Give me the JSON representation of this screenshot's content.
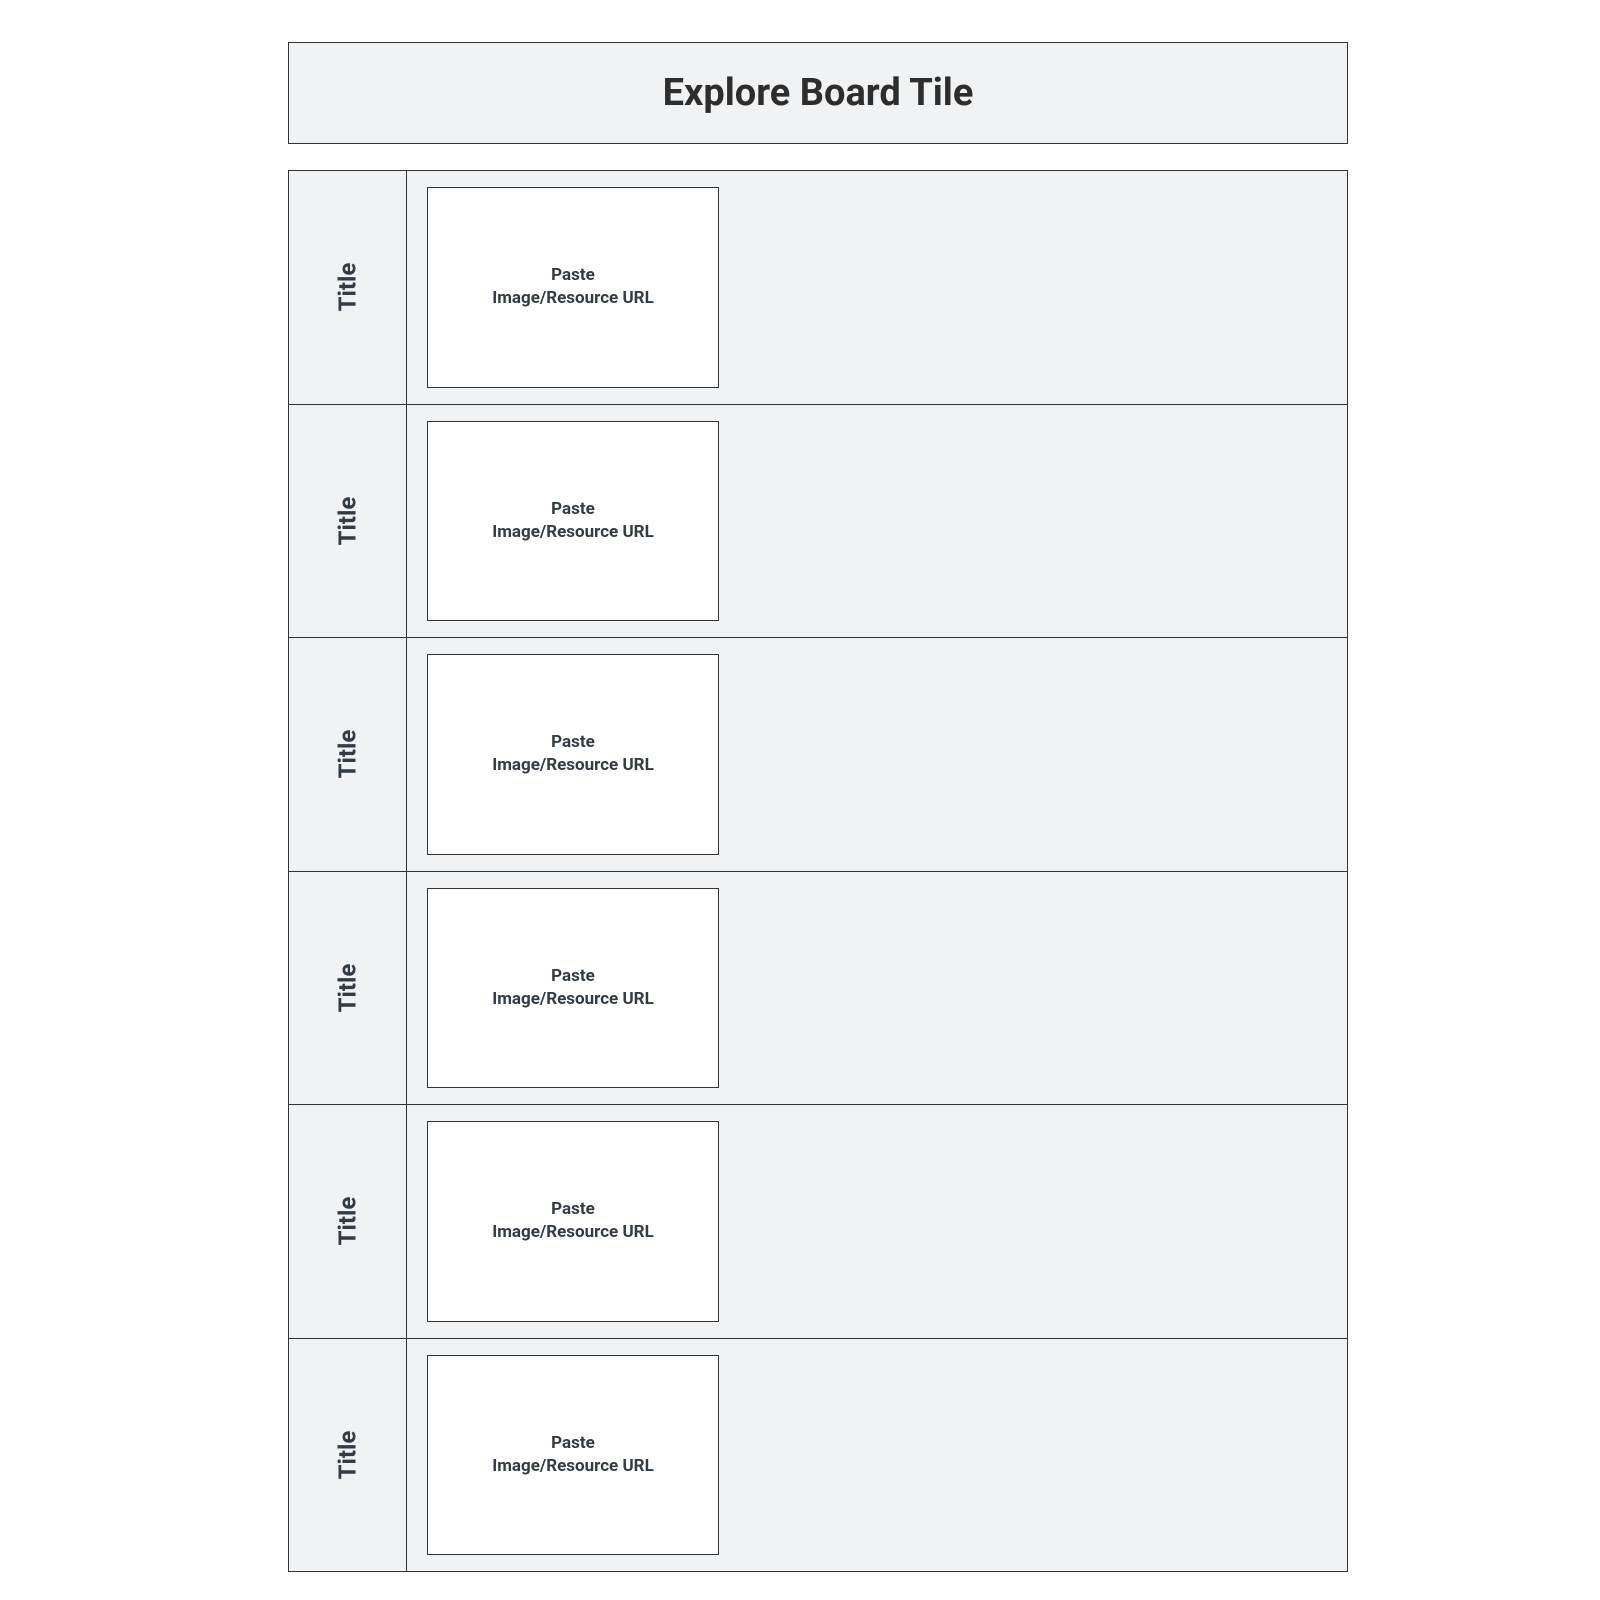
{
  "header": {
    "title": "Explore Board Tile"
  },
  "rows": [
    {
      "title_label": "Title",
      "placeholder_line1": "Paste",
      "placeholder_line2": "Image/Resource URL"
    },
    {
      "title_label": "Title",
      "placeholder_line1": "Paste",
      "placeholder_line2": "Image/Resource URL"
    },
    {
      "title_label": "Title",
      "placeholder_line1": "Paste",
      "placeholder_line2": "Image/Resource URL"
    },
    {
      "title_label": "Title",
      "placeholder_line1": "Paste",
      "placeholder_line2": "Image/Resource URL"
    },
    {
      "title_label": "Title",
      "placeholder_line1": "Paste",
      "placeholder_line2": "Image/Resource URL"
    },
    {
      "title_label": "Title",
      "placeholder_line1": "Paste",
      "placeholder_line2": "Image/Resource URL"
    }
  ]
}
